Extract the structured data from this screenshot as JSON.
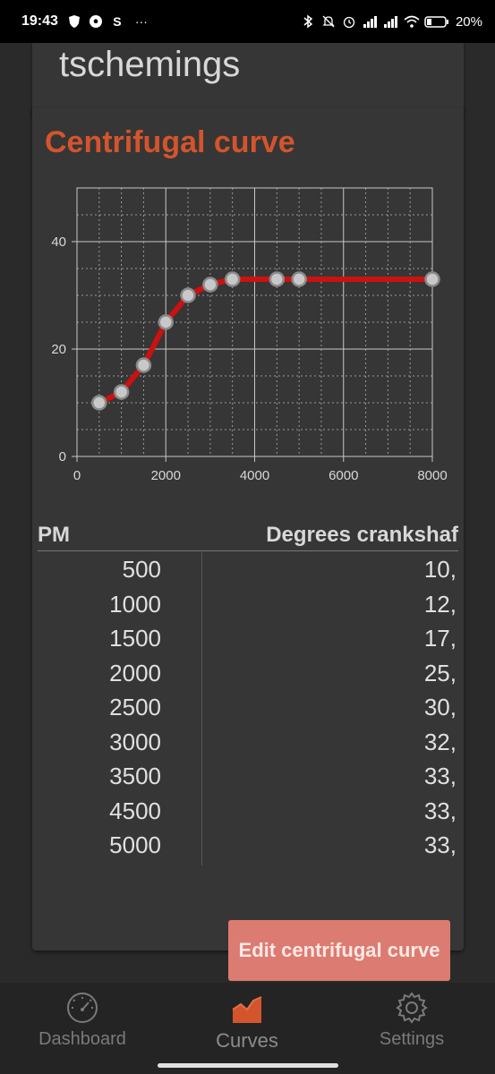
{
  "status_bar": {
    "time": "19:43",
    "left_icons": [
      "shield-icon",
      "football-icon",
      "s-app-icon",
      "more-icon"
    ],
    "right_icons": [
      "bluetooth-icon",
      "mute-icon",
      "alarm-icon",
      "signal-icon",
      "signal-icon",
      "wifi-icon",
      "battery-icon"
    ],
    "battery": "20%"
  },
  "top_card": {
    "title": "tschemings"
  },
  "centrifugal": {
    "heading": "Centrifugal curve",
    "table_header": {
      "rpm": "PM",
      "degrees": "Degrees crankshaf"
    },
    "rows": [
      {
        "rpm": "500",
        "deg": "10,"
      },
      {
        "rpm": "1000",
        "deg": "12,"
      },
      {
        "rpm": "1500",
        "deg": "17,"
      },
      {
        "rpm": "2000",
        "deg": "25,"
      },
      {
        "rpm": "2500",
        "deg": "30,"
      },
      {
        "rpm": "3000",
        "deg": "32,"
      },
      {
        "rpm": "3500",
        "deg": "33,"
      },
      {
        "rpm": "4500",
        "deg": "33,"
      },
      {
        "rpm": "5000",
        "deg": "33,"
      }
    ],
    "edit_button": "Edit centrifugal curve"
  },
  "chart_data": {
    "type": "line",
    "x": [
      500,
      1000,
      1500,
      2000,
      2500,
      3000,
      3500,
      4500,
      5000,
      8000
    ],
    "y": [
      10,
      12,
      17,
      25,
      30,
      32,
      33,
      33,
      33,
      33
    ],
    "xlim": [
      0,
      8000
    ],
    "ylim": [
      0,
      50
    ],
    "x_ticks": [
      0,
      2000,
      4000,
      6000,
      8000
    ],
    "y_ticks": [
      0,
      20,
      40
    ],
    "line_color": "#cc1111",
    "marker_fill": "#c8c8c8",
    "grid": true,
    "title": "",
    "xlabel": "",
    "ylabel": ""
  },
  "bottom_nav": {
    "items": [
      {
        "label": "Dashboard",
        "icon": "gauge-icon",
        "active": false
      },
      {
        "label": "Curves",
        "icon": "area-chart-icon",
        "active": true
      },
      {
        "label": "Settings",
        "icon": "gear-icon",
        "active": false
      }
    ]
  },
  "colors": {
    "accent": "#d4542c",
    "button": "#dc7b71",
    "background": "#2a2a2a",
    "card": "#363636"
  }
}
